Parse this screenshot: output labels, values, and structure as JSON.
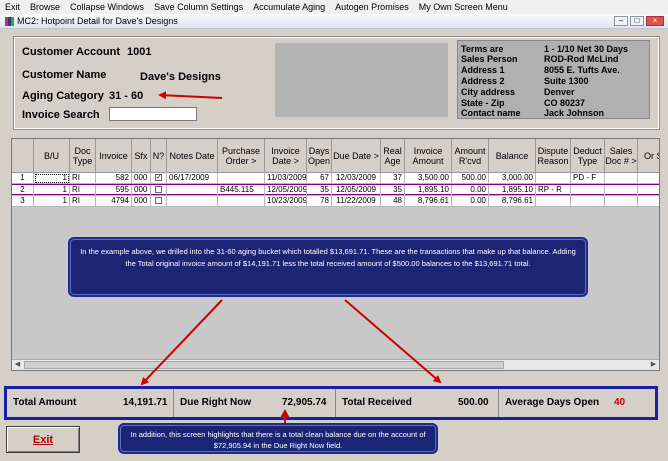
{
  "menu": [
    "Exit",
    "Browse",
    "Collapse Windows",
    "Save Column Settings",
    "Accumulate Aging",
    "Autogen Promises",
    "My Own Screen Menu"
  ],
  "window": {
    "title": "MC2: Hotpoint Detail for Dave's Designs"
  },
  "customer": {
    "account_label": "Customer Account",
    "account_value": "1001",
    "name_label": "Customer Name",
    "name_value": "Dave's Designs",
    "aging_label": "Aging Category",
    "aging_value": "31 - 60",
    "search_label": "Invoice Search",
    "search_value": ""
  },
  "terms_box": [
    {
      "label": "Terms are",
      "value": "1  - 1/10 Net 30 Days"
    },
    {
      "label": "Sales Person",
      "value": "ROD-Rod McLind"
    },
    {
      "label": "Address 1",
      "value": "8055 E. Tufts Ave."
    },
    {
      "label": "Address 2",
      "value": "Suite 1300"
    },
    {
      "label": "City address",
      "value": "Denver"
    },
    {
      "label": "State - Zip",
      "value": "CO  80237"
    },
    {
      "label": "Contact name",
      "value": "Jack Johnson"
    }
  ],
  "grid": {
    "columns": [
      "",
      "B/U",
      "Doc Type",
      "Invoice",
      "Sfx",
      "N?",
      "Notes Date",
      "Purchase Order >",
      "Invoice Date >",
      "Days Open",
      "Due Date >",
      "Real Age",
      "Invoice Amount",
      "Amount R'cvd",
      "Balance",
      "Dispute Reason",
      "Deduct Type",
      "Sales Doc # >",
      "Or St"
    ],
    "rows": [
      [
        "1",
        "1",
        "RI",
        "582",
        "000",
        "✓",
        "06/17/2009",
        "",
        "11/03/2009",
        "67",
        "12/03/2009",
        "37",
        "3,500.00",
        "500.00",
        "3,000.00",
        "",
        "PD   - F",
        "",
        ""
      ],
      [
        "2",
        "1",
        "RI",
        "595",
        "000",
        "",
        "",
        "B445.115",
        "12/05/2009",
        "35",
        "12/05/2009",
        "35",
        "1,895.10",
        "0.00",
        "1,895.10",
        "RP   - R",
        "",
        "",
        ""
      ],
      [
        "3",
        "1",
        "RI",
        "4794",
        "000",
        "",
        "",
        "",
        "10/23/2009",
        "78",
        "11/22/2009",
        "48",
        "8,796.61",
        "0.00",
        "8,796.61",
        "",
        "",
        "",
        ""
      ]
    ]
  },
  "callout1": "In the example above, we drilled into the 31-60 aging bucket which totalled $13,691.71.  These are the transactions that make up that balance.  Adding the Total original invoice amount  of $14,191.71 less the total received amount of $500.00 balances to the $13,691.71 total.",
  "totals": {
    "total_amount_label": "Total Amount",
    "total_amount_value": "14,191.71",
    "due_now_label": "Due Right Now",
    "due_now_value": "72,905.74",
    "received_label": "Total Received",
    "received_value": "500.00",
    "avg_days_label": "Average Days Open",
    "avg_days_value": "40"
  },
  "exit_label": "Exit",
  "callout2": "In addition, this screen highlights that there is a total clean balance due on the account of $72,905.94 in the Due Right Now field.",
  "colors": {
    "accent_red": "#d00000",
    "callout_bg": "#1c2574",
    "totals_border": "#1a1fa8"
  }
}
